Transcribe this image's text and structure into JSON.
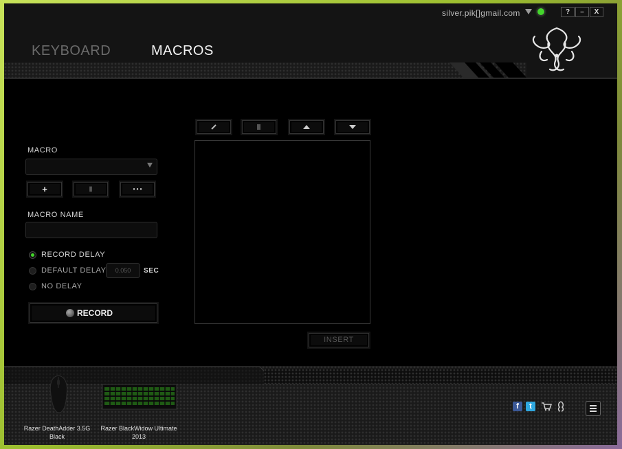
{
  "header": {
    "email": "silver.pik[]gmail.com",
    "help_label": "?",
    "minimize_label": "–",
    "close_label": "X"
  },
  "tabs": [
    {
      "label": "KEYBOARD",
      "active": false
    },
    {
      "label": "MACROS",
      "active": true
    }
  ],
  "macro_panel": {
    "macro_label": "MACRO",
    "macro_select_value": "",
    "add_label": "+",
    "delete_label": "▮",
    "more_label": "• • •",
    "macro_name_label": "MACRO NAME",
    "macro_name_value": "",
    "delay_options": [
      {
        "label": "RECORD DELAY",
        "selected": true
      },
      {
        "label": "DEFAULT DELAY",
        "selected": false
      },
      {
        "label": "NO DELAY",
        "selected": false
      }
    ],
    "default_delay_placeholder": "0.050",
    "delay_unit": "SEC",
    "record_label": "RECORD"
  },
  "editor": {
    "edit_icon": "pencil-icon",
    "delete_icon": "trash-icon",
    "move_up_icon": "arrow-up-icon",
    "move_down_icon": "arrow-down-icon",
    "insert_label": "INSERT"
  },
  "devices": [
    {
      "name_line1": "Razer DeathAdder 3.5G",
      "name_line2": "Black"
    },
    {
      "name_line1": "Razer BlackWidow Ultimate",
      "name_line2": "2013"
    }
  ],
  "social": [
    "facebook-icon",
    "twitter-icon",
    "cart-icon",
    "razer-icon"
  ],
  "colors": {
    "accent": "#44d62c",
    "background": "#000000",
    "text": "#d6d6d6"
  }
}
